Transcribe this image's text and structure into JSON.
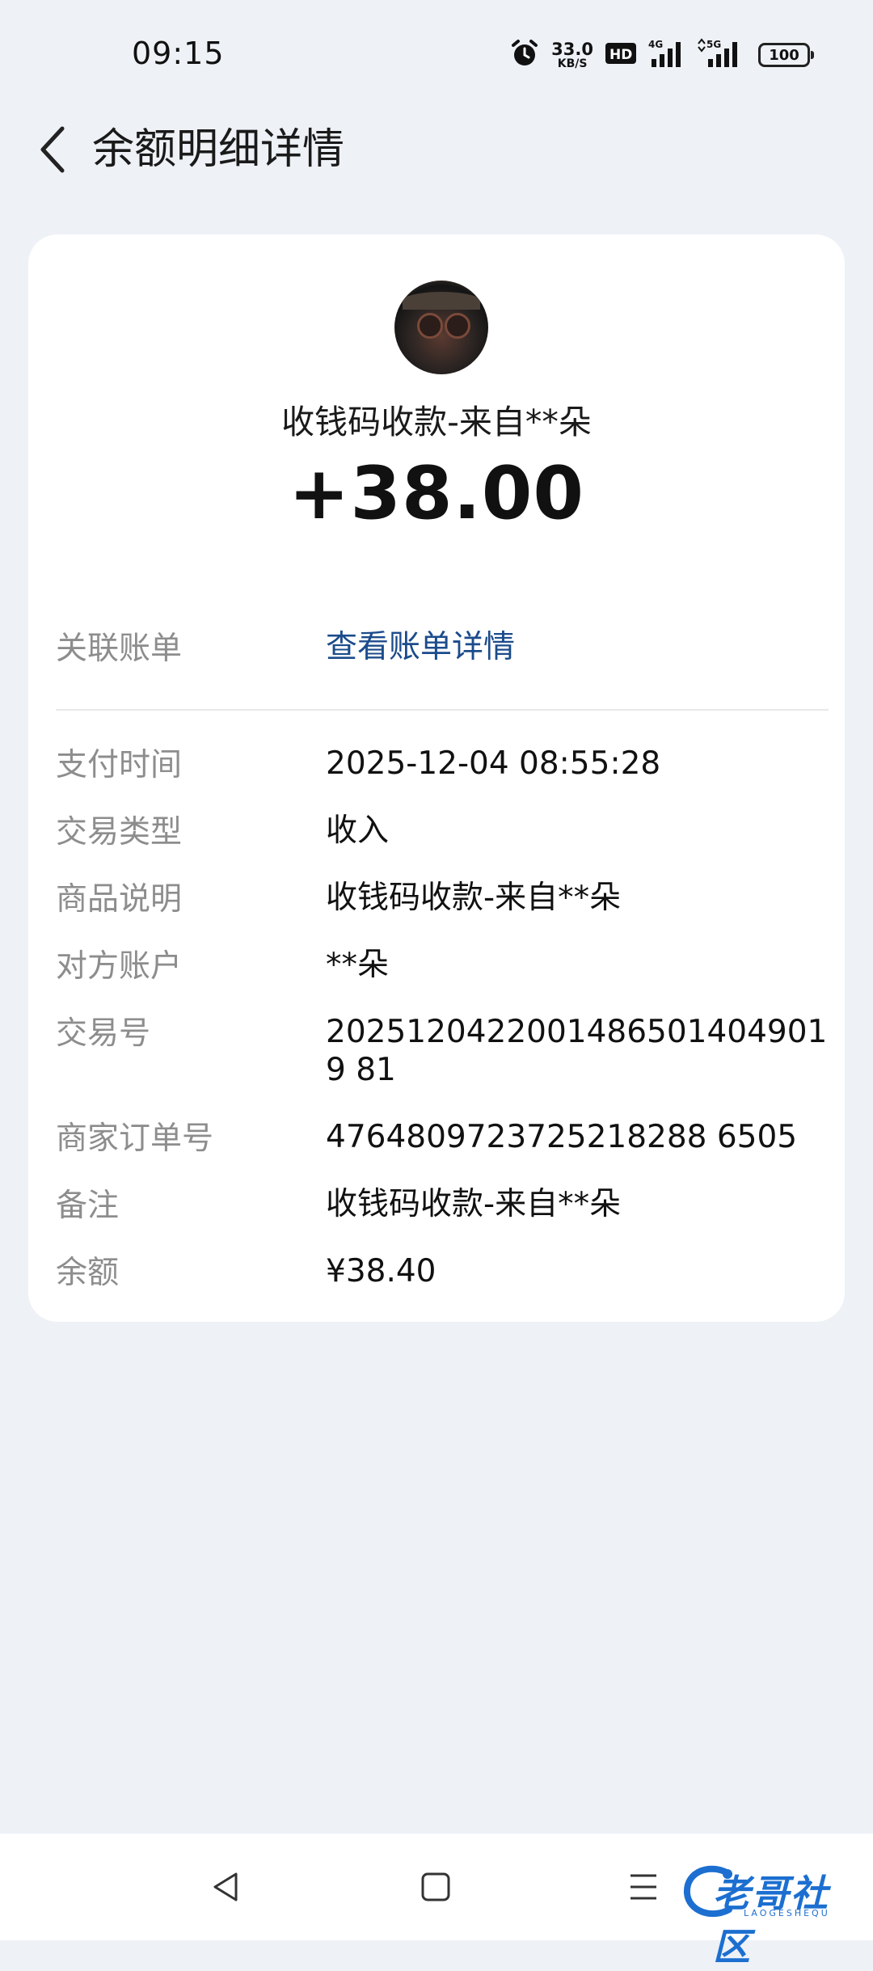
{
  "status_bar": {
    "time": "09:15",
    "net_speed_value": "33.0",
    "net_speed_unit": "KB/S",
    "battery": "100",
    "network_labels": [
      "4G",
      "5G"
    ]
  },
  "header": {
    "title": "余额明细详情"
  },
  "transaction": {
    "title": "收钱码收款-来自**朵",
    "amount": "+38.00"
  },
  "linked_bill": {
    "label": "关联账单",
    "value": "查看账单详情"
  },
  "details": [
    {
      "label": "支付时间",
      "value": "2025-12-04 08:55:28"
    },
    {
      "label": "交易类型",
      "value": "收入"
    },
    {
      "label": "商品说明",
      "value": "收钱码收款-来自**朵"
    },
    {
      "label": "对方账户",
      "value": "**朵"
    },
    {
      "label": "交易号",
      "value": "20251204220014865014049019 81"
    },
    {
      "label": "商家订单号",
      "value": "4764809723725218288 6505"
    },
    {
      "label": "备注",
      "value": "收钱码收款-来自**朵"
    },
    {
      "label": "余额",
      "value": "¥38.40"
    }
  ],
  "watermark": {
    "text": "老哥社区",
    "sub": "LAOGESHEQU"
  },
  "colors": {
    "background": "#eef1f6",
    "card": "#ffffff",
    "link": "#1b4b8b",
    "label": "#8d8d8d"
  }
}
